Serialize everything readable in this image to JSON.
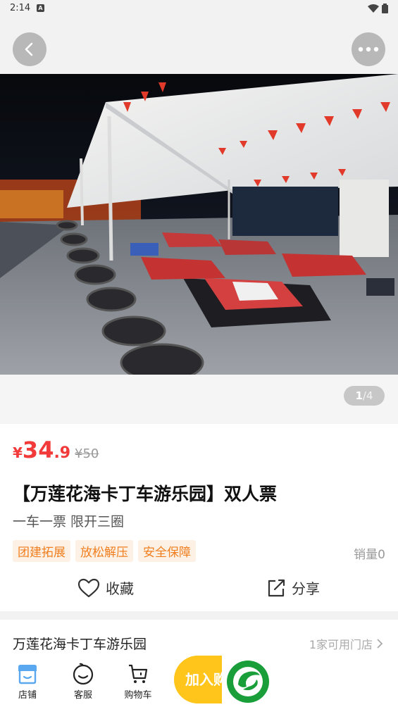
{
  "status": {
    "time": "2:14",
    "notif": "A"
  },
  "nav": {
    "back_icon": "chevron-left-icon",
    "more_icon": "more-dots-icon"
  },
  "gallery": {
    "current": "1",
    "separator": "/",
    "total": "4"
  },
  "product": {
    "currency": "¥",
    "price_int": "34",
    "price_dec": ".9",
    "original_price": "¥50",
    "title": "【万莲花海卡丁车游乐园】双人票",
    "subtitle": "一车一票 限开三圈",
    "tags": [
      "团建拓展",
      "放松解压",
      "安全保障"
    ],
    "sales": "销量0"
  },
  "actions": {
    "favorite": "收藏",
    "share": "分享"
  },
  "store": {
    "name": "万莲花海卡丁车游乐园",
    "count": "1家可用门店"
  },
  "tabbar": {
    "store": "店铺",
    "service": "客服",
    "cart": "购物车",
    "add_to_cart": "加入购物车"
  },
  "colors": {
    "price": "#f23a3a",
    "tag_text": "#f07e1e",
    "tag_bg": "#fdf1e6",
    "add_cart": "#ffc51a",
    "brand": "#1a9e3a",
    "store_icon": "#5aa9f0"
  }
}
